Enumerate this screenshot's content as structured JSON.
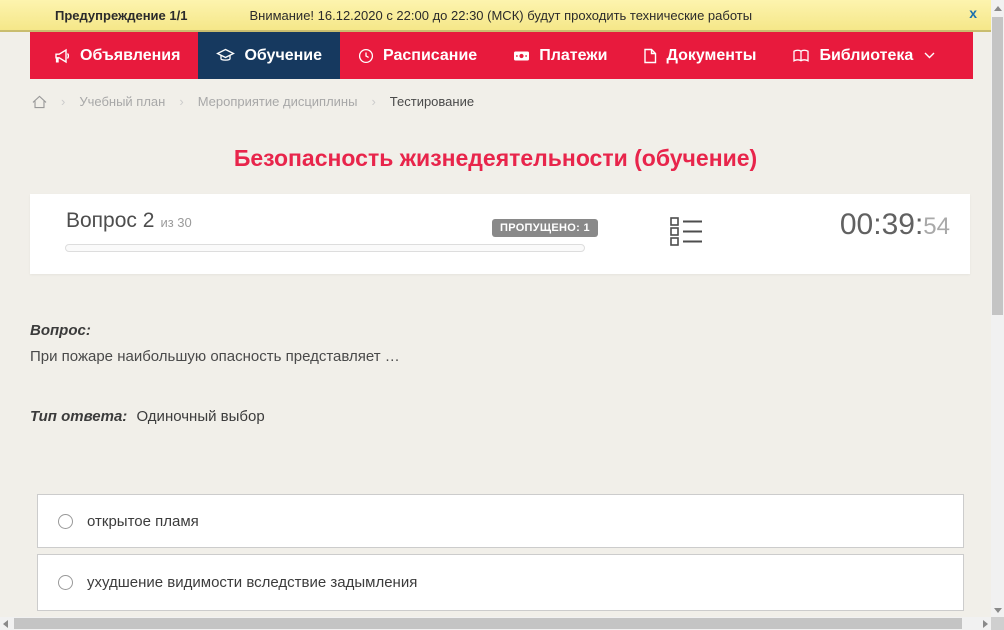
{
  "banner": {
    "label": "Предупреждение 1/1",
    "message": "Внимание! 16.12.2020 с 22:00 до 22:30 (МСК) будут проходить технические работы",
    "close_label": "x"
  },
  "nav": {
    "items": [
      {
        "label": "Объявления",
        "icon": "megaphone-icon",
        "active": false
      },
      {
        "label": "Обучение",
        "icon": "graduation-cap-icon",
        "active": true
      },
      {
        "label": "Расписание",
        "icon": "clock-icon",
        "active": false
      },
      {
        "label": "Платежи",
        "icon": "banknote-icon",
        "active": false
      },
      {
        "label": "Документы",
        "icon": "document-icon",
        "active": false
      },
      {
        "label": "Библиотека",
        "icon": "book-icon",
        "active": false,
        "has_dropdown": true
      }
    ]
  },
  "breadcrumb": {
    "separator": "›",
    "items": [
      "Учебный план",
      "Мероприятие дисциплины",
      "Тестирование"
    ]
  },
  "page": {
    "title": "Безопасность жизнедеятельности (обучение)"
  },
  "quiz": {
    "question_label": "Вопрос 2",
    "question_total": "из 30",
    "skipped_badge": "ПРОПУЩЕНО: 1",
    "timer": "00:39:",
    "timer_seconds": "54",
    "question_heading": "Вопрос:",
    "question_text": "При пожаре наибольшую опасность представляет …",
    "answer_type_label": "Тип ответа:",
    "answer_type_value": "Одиночный выбор",
    "options": [
      {
        "label": "открытое пламя",
        "selected": false
      },
      {
        "label": "ухудшение видимости вследствие задымления",
        "selected": false
      }
    ]
  },
  "colors": {
    "nav_red": "#e81a3d",
    "nav_active_navy": "#16395f",
    "banner_yellow": "#f8ea93",
    "title_red": "#e8254b",
    "badge_gray": "#898989",
    "page_background": "#f1efe9"
  }
}
